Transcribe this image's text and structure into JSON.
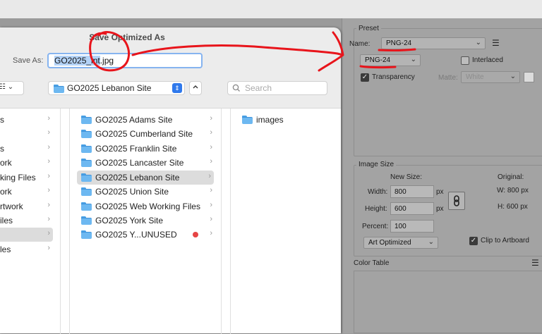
{
  "dialog": {
    "title": "Save Optimized As",
    "save_as_label": "Save As:",
    "filename_selected": "GO2025_int",
    "filename_rest": ".jpg",
    "view_button": "☷ ⌄",
    "location": "GO2025 Lebanon Site",
    "search_placeholder": "Search"
  },
  "browser": {
    "sidebar_fragments": [
      {
        "text": "s",
        "arrow": "›"
      },
      {
        "text": "",
        "arrow": "›"
      },
      {
        "text": "s",
        "arrow": "›"
      },
      {
        "text": "ork",
        "arrow": "›"
      },
      {
        "text": "king Files",
        "arrow": "›"
      },
      {
        "text": "ork",
        "arrow": "›"
      },
      {
        "text": "rtwork",
        "arrow": "›"
      },
      {
        "text": "iles",
        "arrow": "›"
      },
      {
        "text": "",
        "arrow": "›"
      },
      {
        "text": "les",
        "arrow": "›"
      }
    ],
    "folders": [
      {
        "name": "GO2025 Adams Site",
        "arrow": "›"
      },
      {
        "name": "GO2025 Cumberland Site",
        "arrow": "›"
      },
      {
        "name": "GO2025 Franklin Site",
        "arrow": "›"
      },
      {
        "name": "GO2025 Lancaster Site",
        "arrow": "›"
      },
      {
        "name": "GO2025 Lebanon Site",
        "arrow": "›"
      },
      {
        "name": "GO2025 Union Site",
        "arrow": "›"
      },
      {
        "name": "GO2025 Web Working Files",
        "arrow": "›"
      },
      {
        "name": "GO2025 York Site",
        "arrow": "›"
      },
      {
        "name": "GO2025 Y...UNUSED",
        "arrow": "›"
      }
    ],
    "subfolders": [
      {
        "name": "images"
      }
    ]
  },
  "panel": {
    "preset_title": "Preset",
    "name_label": "Name:",
    "name_value": "PNG-24",
    "format_value": "PNG-24",
    "interlaced_label": "Interlaced",
    "transparency_label": "Transparency",
    "matte_label": "Matte:",
    "matte_value": "White",
    "image_size_title": "Image Size",
    "new_size_label": "New Size:",
    "original_label": "Original:",
    "width_label": "Width:",
    "width_value": "800",
    "height_label": "Height:",
    "height_value": "600",
    "px_unit": "px",
    "percent_label": "Percent:",
    "percent_value": "100",
    "orig_w": "W:  800 px",
    "orig_h": "H:  600 px",
    "resample_value": "Art Optimized",
    "clip_label": "Clip to Artboard",
    "color_table_title": "Color Table",
    "chevron": "⌄",
    "check": "✓",
    "menu_icon": "☰"
  },
  "colors": {
    "annotation_red": "#e8141b",
    "selection_blue": "#b3d2f7",
    "focus_ring": "#86b4f0"
  }
}
